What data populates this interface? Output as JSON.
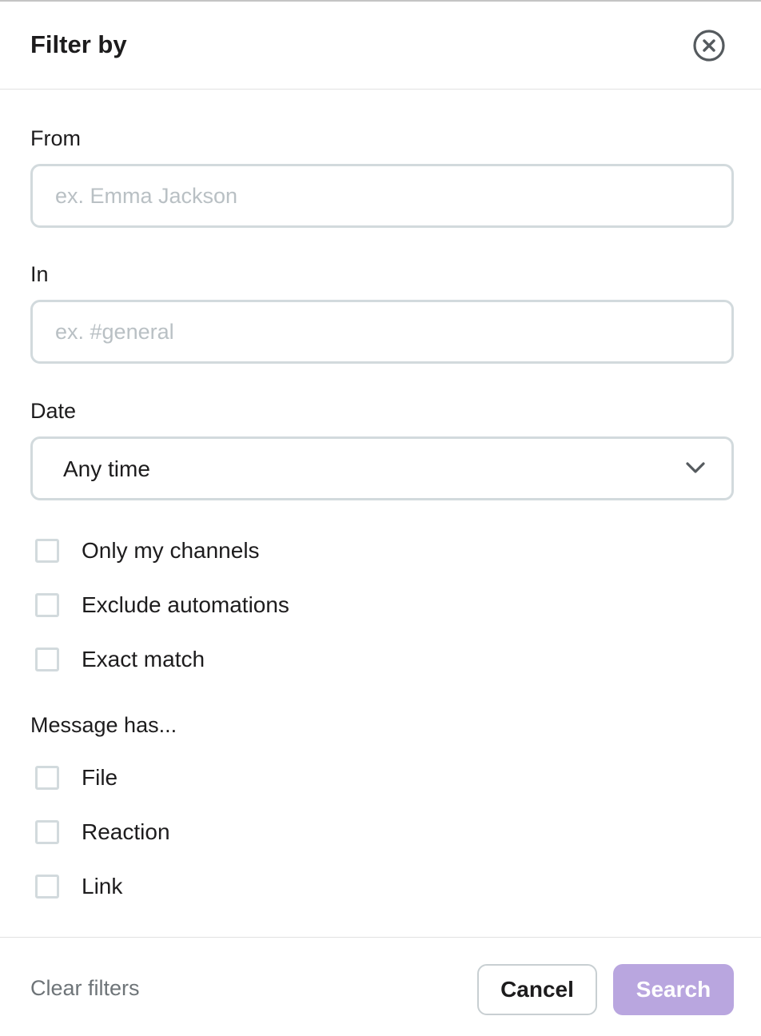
{
  "dialog": {
    "title": "Filter by",
    "close_icon": "close-circle-icon"
  },
  "from": {
    "label": "From",
    "placeholder": "ex. Emma Jackson",
    "value": ""
  },
  "in": {
    "label": "In",
    "placeholder": "ex. #general",
    "value": ""
  },
  "date": {
    "label": "Date",
    "selected": "Any time",
    "icon": "chevron-down-icon"
  },
  "options": [
    {
      "label": "Only my channels",
      "checked": false
    },
    {
      "label": "Exclude automations",
      "checked": false
    },
    {
      "label": "Exact match",
      "checked": false
    }
  ],
  "message_has": {
    "label": "Message has...",
    "items": [
      {
        "label": "File",
        "checked": false
      },
      {
        "label": "Reaction",
        "checked": false
      },
      {
        "label": "Link",
        "checked": false
      }
    ]
  },
  "footer": {
    "clear_label": "Clear filters",
    "cancel_label": "Cancel",
    "search_label": "Search"
  },
  "colors": {
    "search_button": "#b9a6df",
    "input_border": "#d2dadd",
    "placeholder": "#b9c0c4"
  }
}
